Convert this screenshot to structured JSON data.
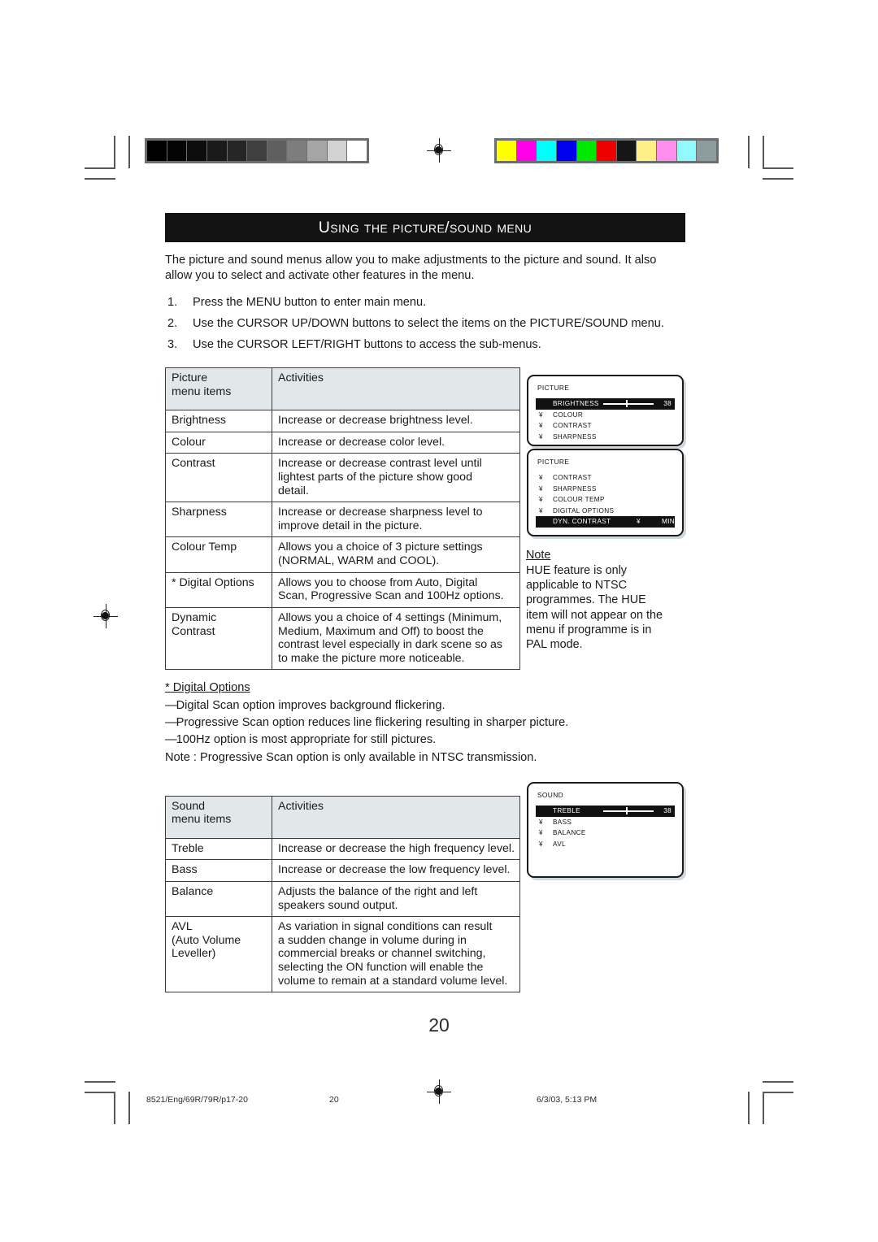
{
  "section": {
    "banner_title": "Using the Picture/Sound Menu",
    "intro": "The picture and sound menus allow you to make adjustments to the picture and sound. It also allow you to select and activate other features in the menu.",
    "steps": [
      {
        "num": "1.",
        "text": "Press the MENU button to enter main menu."
      },
      {
        "num": "2.",
        "text": "Use the CURSOR UP/DOWN buttons to select the items on the PICTURE/SOUND menu."
      },
      {
        "num": "3.",
        "text": "Use the CURSOR LEFT/RIGHT buttons to access the sub-menus."
      }
    ]
  },
  "picture_table": {
    "header": {
      "col1_line1": "Picture",
      "col1_line2": "menu items",
      "col2": "Activities"
    },
    "rows": [
      {
        "item": [
          "Brightness"
        ],
        "activity": [
          "  Increase or decrease brightness level."
        ]
      },
      {
        "item": [
          "Colour"
        ],
        "activity": [
          " Increase or decrease color level."
        ]
      },
      {
        "item": [
          "Contrast"
        ],
        "activity": [
          "  Increase or decrease contrast level until",
          "lightest parts of the picture show good",
          "detail."
        ]
      },
      {
        "item": [
          "Sharpness"
        ],
        "activity": [
          "   Increase or decrease sharpness level to",
          "improve detail in the picture."
        ]
      },
      {
        "item": [
          "Colour Temp"
        ],
        "activity": [
          "  Allows you a choice of 3 picture settings",
          "(NORMAL, WARM and COOL)."
        ]
      },
      {
        "item": [
          "* Digital Options"
        ],
        "activity": [
          "  Allows you to choose from Auto, Digital",
          "Scan, Progressive Scan and 100Hz options."
        ]
      },
      {
        "item": [
          "Dynamic",
          "Contrast"
        ],
        "activity": [
          "  Allows you a choice of 4 settings (Minimum,",
          "Medium, Maximum and Off) to  boost the",
          "contrast level especially in dark scene so as",
          "to make the picture more noticeable."
        ]
      }
    ]
  },
  "digital_options": {
    "title": "* Digital Options",
    "bullets": [
      "Digital Scan option improves background flickering.",
      "Progressive Scan option reduces line flickering resulting in sharper picture.",
      "100Hz option is most appropriate for still pictures."
    ],
    "dash": "—",
    "note": "Note : Progressive Scan option is only available in NTSC transmission."
  },
  "sound_table": {
    "header": {
      "col1_line1": "Sound",
      "col1_line2": "menu items",
      "col2": "Activities"
    },
    "rows": [
      {
        "item": [
          "Treble"
        ],
        "activity": [
          "  Increase or decrease the high frequency level."
        ]
      },
      {
        "item": [
          "Bass"
        ],
        "activity": [
          "   Increase or decrease the low frequency level."
        ]
      },
      {
        "item": [
          "Balance"
        ],
        "activity": [
          "   Adjusts the balance of the right and left",
          "speakers  sound output."
        ]
      },
      {
        "item": [
          "AVL",
          "(Auto Volume",
          "Leveller)"
        ],
        "activity": [
          " As variation in signal conditions can result",
          " a sudden change in volume during in",
          "  commercial breaks or channel switching,",
          " selecting the  ON  function will enable the",
          " volume to remain at a standard volume level."
        ]
      }
    ]
  },
  "osd_picture_1": {
    "title": "PICTURE",
    "rows": [
      {
        "mark": "",
        "label": "BRIGHTNESS",
        "value": "38",
        "selected": true,
        "slider": true
      },
      {
        "mark": "¥",
        "label": "COLOUR",
        "selected": false
      },
      {
        "mark": "¥",
        "label": "CONTRAST",
        "selected": false
      },
      {
        "mark": "¥",
        "label": "SHARPNESS",
        "selected": false
      }
    ]
  },
  "osd_picture_2": {
    "title": "PICTURE",
    "rows": [
      {
        "mark": "¥",
        "label": "CONTRAST",
        "selected": false
      },
      {
        "mark": "¥",
        "label": "SHARPNESS",
        "selected": false
      },
      {
        "mark": "¥",
        "label": "COLOUR TEMP",
        "selected": false
      },
      {
        "mark": "¥",
        "label": "DIGITAL OPTIONS",
        "selected": false
      },
      {
        "mark": "",
        "label": "DYN. CONTRAST",
        "mark2": "¥",
        "value": "MIN",
        "selected": true
      }
    ]
  },
  "osd_sound": {
    "title": "SOUND",
    "rows": [
      {
        "mark": "",
        "label": "TREBLE",
        "value": "38",
        "selected": true,
        "slider": true
      },
      {
        "mark": "¥",
        "label": "BASS",
        "selected": false
      },
      {
        "mark": "¥",
        "label": "BALANCE",
        "selected": false
      },
      {
        "mark": "¥",
        "label": "AVL",
        "selected": false
      }
    ]
  },
  "side_note": {
    "header": "Note",
    "lines": [
      "HUE  feature is only",
      "applicable to NTSC",
      "programmes. The HUE",
      "item will not appear on the",
      "menu if programme is in",
      "PAL mode."
    ]
  },
  "footer": {
    "page_number": "20",
    "file_ref": "8521/Eng/69R/79R/p17-20",
    "folio": "20",
    "timestamp": "6/3/03, 5:13 PM"
  },
  "calibration": {
    "grayscale": [
      "#000000",
      "#040404",
      "#0d0d0d",
      "#1a1a1a",
      "#262626",
      "#3f3f3f",
      "#5f5f5f",
      "#7d7d7d",
      "#a5a5a5",
      "#d2d2d2",
      "#ffffff"
    ],
    "colors": [
      "#ffff00",
      "#ff00e8",
      "#00ffff",
      "#0000ee",
      "#00e800",
      "#ee0000",
      "#161616",
      "#ffef84",
      "#ff8ef0",
      "#8ffbff",
      "#8d9c9e"
    ]
  }
}
